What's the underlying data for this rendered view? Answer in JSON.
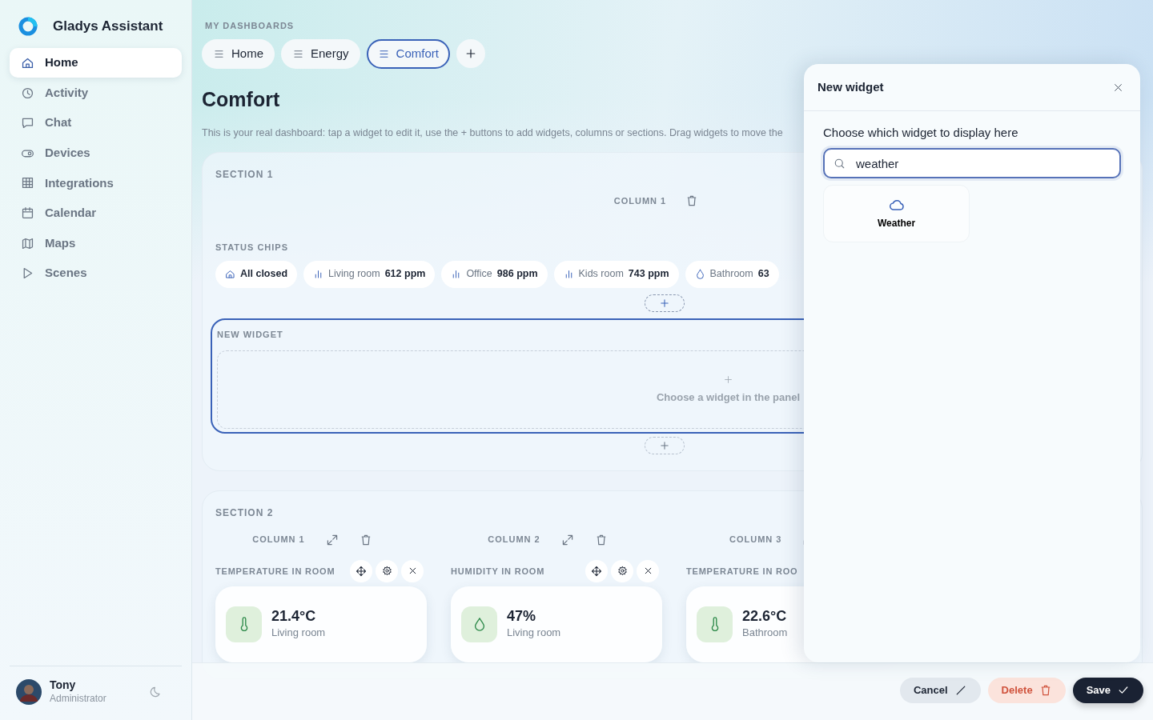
{
  "app": {
    "name": "Gladys Assistant"
  },
  "nav": [
    {
      "label": "Home",
      "selected": true
    },
    {
      "label": "Activity",
      "selected": false
    },
    {
      "label": "Chat",
      "selected": false
    },
    {
      "label": "Devices",
      "selected": false
    },
    {
      "label": "Integrations",
      "selected": false
    },
    {
      "label": "Calendar",
      "selected": false
    },
    {
      "label": "Maps",
      "selected": false
    },
    {
      "label": "Scenes",
      "selected": false
    }
  ],
  "user": {
    "name": "Tony",
    "role": "Administrator"
  },
  "dashboards": {
    "heading": "MY DASHBOARDS",
    "tabs": [
      {
        "label": "Home",
        "selected": false
      },
      {
        "label": "Energy",
        "selected": false
      },
      {
        "label": "Comfort",
        "selected": true
      }
    ]
  },
  "page": {
    "title": "Comfort",
    "description": "This is your real dashboard: tap a widget to edit it, use the + buttons to add widgets, columns or sections. Drag widgets to move the"
  },
  "section1": {
    "title": "SECTION 1",
    "column": "COLUMN 1",
    "widgets": [
      {
        "kind": "chips",
        "title": "STATUS CHIPS",
        "chips": [
          {
            "kind": "state",
            "label": "All closed"
          },
          {
            "kind": "co2",
            "label": "Living room",
            "value": "612 ppm"
          },
          {
            "kind": "co2",
            "label": "Office",
            "value": "986 ppm"
          },
          {
            "kind": "co2",
            "label": "Kids room",
            "value": "743 ppm"
          },
          {
            "kind": "humidity",
            "label": "Bathroom",
            "value": "63"
          }
        ]
      },
      {
        "kind": "new",
        "title": "NEW WIDGET",
        "hint": "Choose a widget in the panel",
        "selected": true
      }
    ]
  },
  "section2": {
    "title": "SECTION 2",
    "columns": [
      {
        "title": "COLUMN 1",
        "widget": {
          "kind": "temperature",
          "title": "TEMPERATURE IN ROOM",
          "value": "21.4°C",
          "room": "Living room"
        }
      },
      {
        "title": "COLUMN 2",
        "widget": {
          "kind": "humidity",
          "title": "HUMIDITY IN ROOM",
          "value": "47%",
          "room": "Living room"
        }
      },
      {
        "title": "COLUMN 3",
        "widget": {
          "kind": "temperature",
          "title": "TEMPERATURE IN ROO",
          "value": "22.6°C",
          "room": "Bathroom"
        }
      }
    ]
  },
  "panel": {
    "title": "New widget",
    "label": "Choose which widget to display here",
    "search": "weather",
    "results": [
      {
        "label": "Weather"
      }
    ]
  },
  "actions": [
    {
      "kind": "cancel",
      "label": "Cancel"
    },
    {
      "kind": "delete",
      "label": "Delete"
    },
    {
      "kind": "save",
      "label": "Save"
    }
  ]
}
